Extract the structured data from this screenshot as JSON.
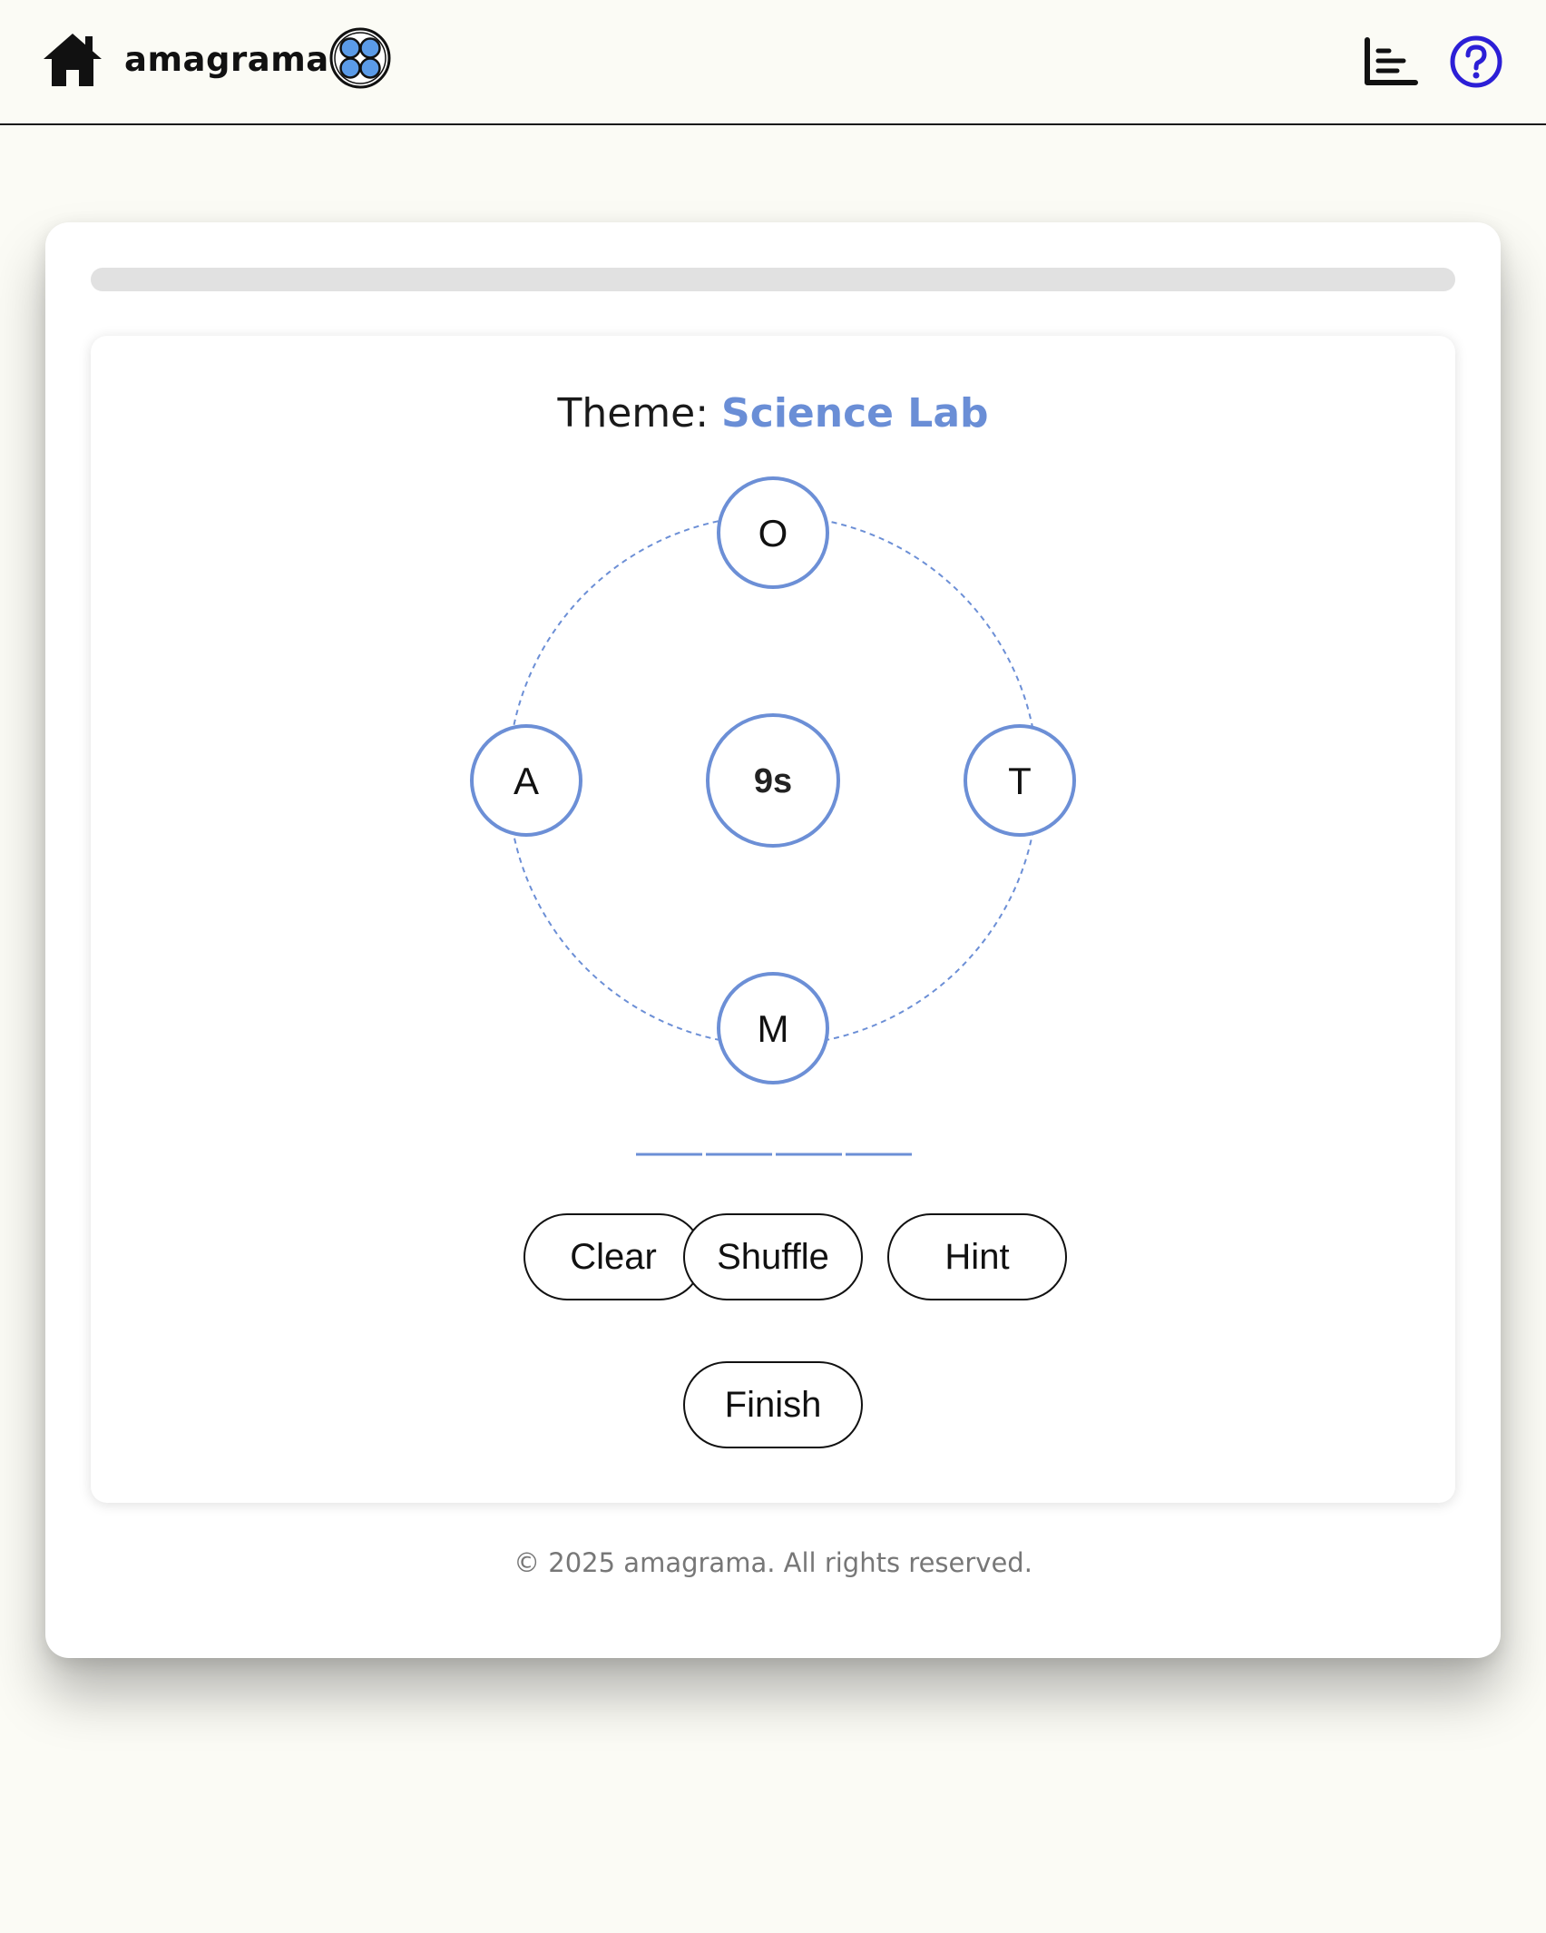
{
  "header": {
    "brand": "amagrama",
    "home_icon": "home-icon",
    "logo_icon": "four-bubbles-logo",
    "stats_icon": "bar-chart-icon",
    "help_icon": "question-circle-icon",
    "help_color": "#2c1fd6"
  },
  "game": {
    "progress": 0,
    "theme_label": "Theme:",
    "theme_value": "Science Lab",
    "accent_color": "#6c8fd6",
    "letters": [
      "O",
      "T",
      "M",
      "A"
    ],
    "timer": "9s",
    "answer_slots": 4
  },
  "buttons": {
    "clear": "Clear",
    "shuffle": "Shuffle",
    "hint": "Hint",
    "finish": "Finish"
  },
  "footer": {
    "copyright": "© 2025 amagrama. All rights reserved."
  }
}
